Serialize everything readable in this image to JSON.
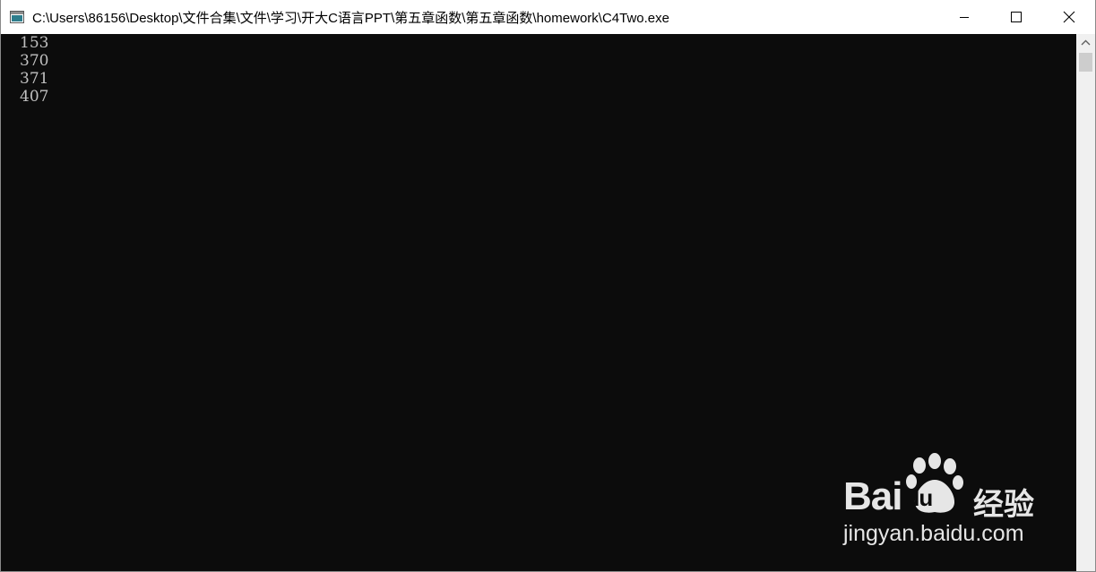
{
  "window": {
    "title": "C:\\Users\\86156\\Desktop\\文件合集\\文件\\学习\\开大C语言PPT\\第五章函数\\第五章函数\\homework\\C4Two.exe",
    "icon": "console-app-icon",
    "controls": {
      "minimize_icon": "minimize-icon",
      "maximize_icon": "maximize-icon",
      "close_icon": "close-icon"
    }
  },
  "console": {
    "background": "#0c0c0c",
    "text_color": "#c0c0c0",
    "lines": [
      "153",
      "370",
      "371",
      "407"
    ]
  },
  "watermark": {
    "brand_left": "Bai",
    "brand_right": "du",
    "service": "经验",
    "url": "jingyan.baidu.com",
    "icon": "baidu-paw-icon",
    "color": "#e6e6e6"
  }
}
